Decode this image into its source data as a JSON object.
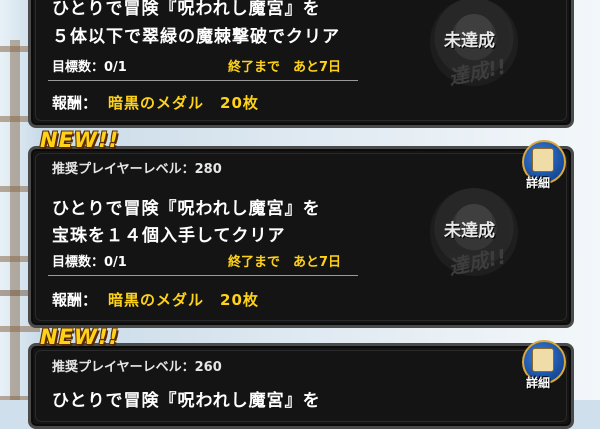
{
  "missions": [
    {
      "new_badge": "",
      "level": "",
      "description_line1": "ひとりで冒険『呪われし魔宮』を",
      "description_line2": "５体以下で翠緑の魔棘撃破でクリア",
      "progress": "目標数：0/1",
      "deadline": "終了まで　あと7日",
      "reward_label": "報酬：",
      "reward_value": "暗黒のメダル　20枚",
      "status": "未達成",
      "status_stamp": "達成!!",
      "detail_label": ""
    },
    {
      "new_badge": "NEW!!",
      "level": "推奨プレイヤーレベル：280",
      "description_line1": "ひとりで冒険『呪われし魔宮』を",
      "description_line2": "宝珠を１４個入手してクリア",
      "progress": "目標数：0/1",
      "deadline": "終了まで　あと7日",
      "reward_label": "報酬：",
      "reward_value": "暗黒のメダル　20枚",
      "status": "未達成",
      "status_stamp": "達成!!",
      "detail_label": "詳細"
    },
    {
      "new_badge": "NEW!!",
      "level": "推奨プレイヤーレベル：260",
      "description_line1": "ひとりで冒険『呪われし魔宮』を",
      "detail_label": "詳細"
    }
  ],
  "icons": {
    "detail": "scroll-icon",
    "status": "seal-icon"
  },
  "colors": {
    "accent_gold": "#ffd21a",
    "card_bg": "#141414"
  }
}
